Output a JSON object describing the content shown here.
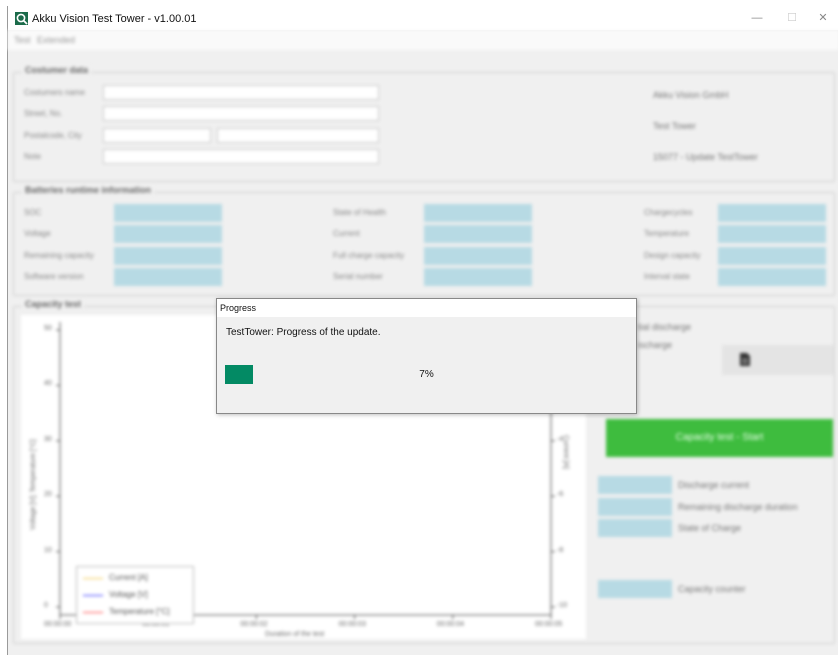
{
  "window": {
    "title": "Akku Vision Test Tower - v1.00.01",
    "controls": {
      "minimize": "—",
      "maximize": "☐",
      "close": "✕"
    }
  },
  "menu": {
    "items": [
      "Test",
      "Extended"
    ]
  },
  "customer": {
    "title": "Costumer data",
    "labels": [
      "Costumers name",
      "Street, No.",
      "Postalcode, City",
      "Note"
    ],
    "company": [
      "Akku Vision GmbH",
      "Test Tower",
      "15077 - Update TestTower"
    ]
  },
  "battery": {
    "title": "Batteries runtime information",
    "col1": [
      "SOC",
      "Voltage",
      "Remaining capacity",
      "Software version"
    ],
    "col2": [
      "State of Health",
      "Current",
      "Full charge capacity",
      "Serial number"
    ],
    "col3": [
      "Chargecycles",
      "Temperature",
      "Design capacity",
      "Interval state"
    ]
  },
  "capacity": {
    "title": "Capacity test",
    "side_labels": [
      "tial discharge",
      "ischarge"
    ],
    "start_button": "Capacity test - Start",
    "info": [
      "Discharge current",
      "Remaining discharge duration",
      "State of Charge"
    ],
    "counter": "Capacity counter"
  },
  "chart_data": {
    "type": "line",
    "title": "",
    "xlabel": "Duration of the test",
    "ylabel": "Voltage [V]; Temperature [°C]",
    "y2label": "Current [A]",
    "x_ticks": [
      "00:00:00",
      "00:00:01",
      "00:00:02",
      "00:00:03",
      "00:00:04",
      "00:00:05"
    ],
    "y_ticks": [
      "0",
      "10",
      "20",
      "30",
      "40",
      "50"
    ],
    "y2_ticks": [
      "-10",
      "-8",
      "-6",
      "-4",
      "-2"
    ],
    "series": [
      {
        "name": "Current [A]",
        "color": "#f2c94c",
        "values": []
      },
      {
        "name": "Voltage [V]",
        "color": "#3a3aff",
        "values": []
      },
      {
        "name": "Temperature [°C]",
        "color": "#ff4a4a",
        "values": []
      }
    ]
  },
  "dialog": {
    "title": "Progress",
    "message": "TestTower: Progress of the update.",
    "percent_text": "7%",
    "progress": 0.07,
    "bar_color": "#038a64"
  }
}
